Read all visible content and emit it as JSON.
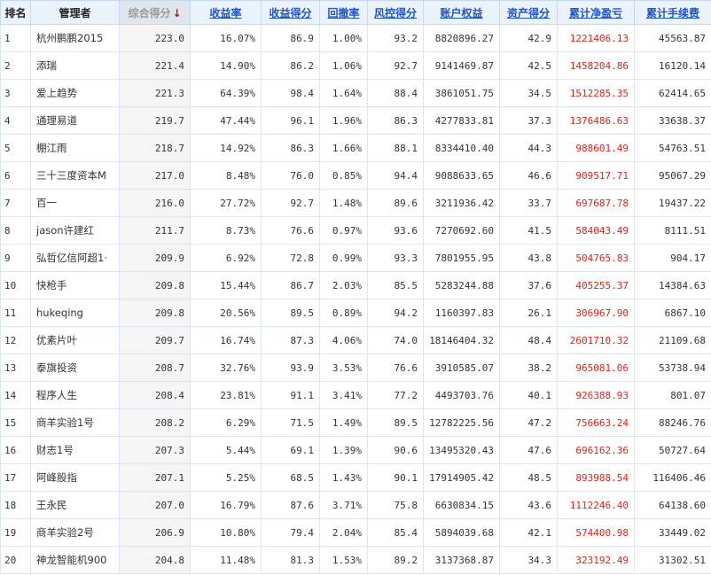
{
  "table": {
    "headers": {
      "rank": "排名",
      "manager": "管理者",
      "score": "综合得分",
      "return_rate": "收益率",
      "return_score": "收益得分",
      "drawdown": "回撤率",
      "risk_score": "风控得分",
      "equity": "账户权益",
      "asset_score": "资产得分",
      "net_pnl": "累计净盈亏",
      "fees": "累计手续费"
    },
    "sort_arrow": "↓",
    "rows": [
      {
        "rank": "1",
        "manager": "杭州鹏鹏2015",
        "score": "223.0",
        "return_rate": "16.07%",
        "return_score": "86.9",
        "drawdown": "1.00%",
        "risk_score": "93.2",
        "equity": "8820896.27",
        "asset_score": "42.9",
        "net_pnl": "1221406.13",
        "fees": "45563.87"
      },
      {
        "rank": "2",
        "manager": "添瑞",
        "score": "221.4",
        "return_rate": "14.90%",
        "return_score": "86.2",
        "drawdown": "1.06%",
        "risk_score": "92.7",
        "equity": "9141469.87",
        "asset_score": "42.5",
        "net_pnl": "1458204.86",
        "fees": "16120.14"
      },
      {
        "rank": "3",
        "manager": "爱上趋势",
        "score": "221.3",
        "return_rate": "64.39%",
        "return_score": "98.4",
        "drawdown": "1.64%",
        "risk_score": "88.4",
        "equity": "3861051.75",
        "asset_score": "34.5",
        "net_pnl": "1512285.35",
        "fees": "62414.65"
      },
      {
        "rank": "4",
        "manager": "通理易道",
        "score": "219.7",
        "return_rate": "47.44%",
        "return_score": "96.1",
        "drawdown": "1.96%",
        "risk_score": "86.3",
        "equity": "4277833.81",
        "asset_score": "37.3",
        "net_pnl": "1376486.63",
        "fees": "33638.37"
      },
      {
        "rank": "5",
        "manager": "棚江雨",
        "score": "218.7",
        "return_rate": "14.92%",
        "return_score": "86.3",
        "drawdown": "1.66%",
        "risk_score": "88.1",
        "equity": "8334410.40",
        "asset_score": "44.3",
        "net_pnl": "988601.49",
        "fees": "54763.51"
      },
      {
        "rank": "6",
        "manager": "三十三度资本M",
        "score": "217.0",
        "return_rate": "8.48%",
        "return_score": "76.0",
        "drawdown": "0.85%",
        "risk_score": "94.4",
        "equity": "9088633.65",
        "asset_score": "46.6",
        "net_pnl": "909517.71",
        "fees": "95067.29"
      },
      {
        "rank": "7",
        "manager": "百一",
        "score": "216.0",
        "return_rate": "27.72%",
        "return_score": "92.7",
        "drawdown": "1.48%",
        "risk_score": "89.6",
        "equity": "3211936.42",
        "asset_score": "33.7",
        "net_pnl": "697687.78",
        "fees": "19437.22"
      },
      {
        "rank": "8",
        "manager": "jason许建红",
        "score": "211.7",
        "return_rate": "8.73%",
        "return_score": "76.6",
        "drawdown": "0.97%",
        "risk_score": "93.6",
        "equity": "7270692.60",
        "asset_score": "41.5",
        "net_pnl": "584043.49",
        "fees": "8111.51"
      },
      {
        "rank": "9",
        "manager": "弘哲亿信阿超1·",
        "score": "209.9",
        "return_rate": "6.92%",
        "return_score": "72.8",
        "drawdown": "0.99%",
        "risk_score": "93.3",
        "equity": "7801955.95",
        "asset_score": "43.8",
        "net_pnl": "504765.83",
        "fees": "904.17"
      },
      {
        "rank": "10",
        "manager": "快枪手",
        "score": "209.8",
        "return_rate": "15.44%",
        "return_score": "86.7",
        "drawdown": "2.03%",
        "risk_score": "85.5",
        "equity": "5283244.88",
        "asset_score": "37.6",
        "net_pnl": "405255.37",
        "fees": "14384.63"
      },
      {
        "rank": "11",
        "manager": "hukeqing",
        "score": "209.8",
        "return_rate": "20.56%",
        "return_score": "89.5",
        "drawdown": "0.89%",
        "risk_score": "94.2",
        "equity": "1160397.83",
        "asset_score": "26.1",
        "net_pnl": "306967.90",
        "fees": "6867.10"
      },
      {
        "rank": "12",
        "manager": "优素片叶",
        "score": "209.7",
        "return_rate": "16.74%",
        "return_score": "87.3",
        "drawdown": "4.06%",
        "risk_score": "74.0",
        "equity": "18146404.32",
        "asset_score": "48.4",
        "net_pnl": "2601710.32",
        "fees": "21109.68"
      },
      {
        "rank": "13",
        "manager": "泰旗投资",
        "score": "208.7",
        "return_rate": "32.76%",
        "return_score": "93.9",
        "drawdown": "3.53%",
        "risk_score": "76.6",
        "equity": "3910585.07",
        "asset_score": "38.2",
        "net_pnl": "965081.06",
        "fees": "53738.94"
      },
      {
        "rank": "14",
        "manager": "程序人生",
        "score": "208.4",
        "return_rate": "23.81%",
        "return_score": "91.1",
        "drawdown": "3.41%",
        "risk_score": "77.2",
        "equity": "4493703.76",
        "asset_score": "40.1",
        "net_pnl": "926388.93",
        "fees": "801.07"
      },
      {
        "rank": "15",
        "manager": "商羊实验1号",
        "score": "208.2",
        "return_rate": "6.29%",
        "return_score": "71.5",
        "drawdown": "1.49%",
        "risk_score": "89.5",
        "equity": "12782225.56",
        "asset_score": "47.2",
        "net_pnl": "756663.24",
        "fees": "88246.76"
      },
      {
        "rank": "16",
        "manager": "财志1号",
        "score": "207.3",
        "return_rate": "5.44%",
        "return_score": "69.1",
        "drawdown": "1.39%",
        "risk_score": "90.6",
        "equity": "13495320.43",
        "asset_score": "47.6",
        "net_pnl": "696162.36",
        "fees": "50727.64"
      },
      {
        "rank": "17",
        "manager": "阿峰股指",
        "score": "207.1",
        "return_rate": "5.25%",
        "return_score": "68.5",
        "drawdown": "1.43%",
        "risk_score": "90.1",
        "equity": "17914905.42",
        "asset_score": "48.5",
        "net_pnl": "893988.54",
        "fees": "116406.46"
      },
      {
        "rank": "18",
        "manager": "王永民",
        "score": "207.0",
        "return_rate": "16.79%",
        "return_score": "87.6",
        "drawdown": "3.71%",
        "risk_score": "75.8",
        "equity": "6630834.15",
        "asset_score": "43.6",
        "net_pnl": "1112246.40",
        "fees": "64138.60"
      },
      {
        "rank": "19",
        "manager": "商羊实验2号",
        "score": "206.9",
        "return_rate": "10.80%",
        "return_score": "79.4",
        "drawdown": "2.04%",
        "risk_score": "85.4",
        "equity": "5894039.68",
        "asset_score": "42.1",
        "net_pnl": "574400.98",
        "fees": "33449.02"
      },
      {
        "rank": "20",
        "manager": "神龙智能机900",
        "score": "204.8",
        "return_rate": "11.48%",
        "return_score": "81.3",
        "drawdown": "1.53%",
        "risk_score": "89.2",
        "equity": "3137368.87",
        "asset_score": "34.3",
        "net_pnl": "323192.49",
        "fees": "31302.51"
      }
    ]
  },
  "colors": {
    "header_bg": "#eaf2fb",
    "link": "#1f55c7",
    "pnl_red": "#e2231a",
    "sort_arrow_red": "#e00000"
  }
}
